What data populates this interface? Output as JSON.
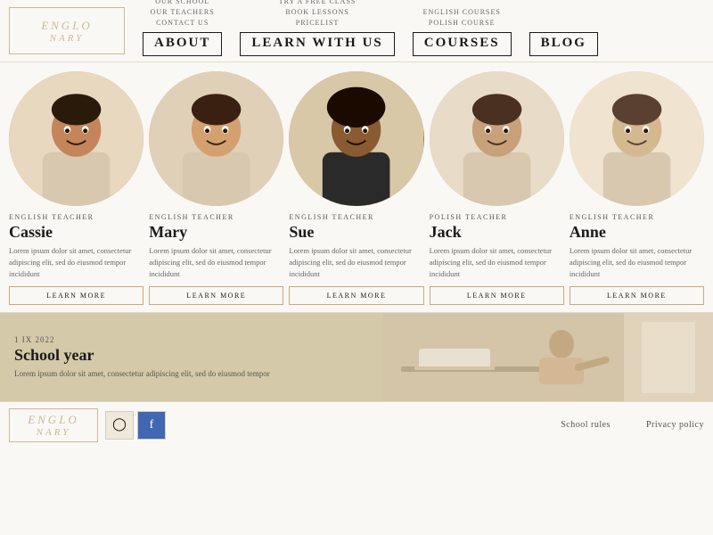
{
  "logo": {
    "line1": "ENGLO",
    "line2": "NARY"
  },
  "nav": {
    "about": {
      "label": "ABOUT",
      "sub_links": [
        "OUR SCHOOL",
        "OUR TEACHERS",
        "CONTACT US"
      ]
    },
    "learn": {
      "label": "LEARN WITH US",
      "sub_links": [
        "TRY A FREE CLASS",
        "BOOK LESSONS",
        "PRICELIST"
      ]
    },
    "courses": {
      "label": "COURSES",
      "sub_links": [
        "ENGLISH COURSES",
        "POLISH COURSE"
      ]
    },
    "blog": {
      "label": "BLOG",
      "sub_links": []
    }
  },
  "teachers": [
    {
      "role": "ENGLISH TEACHER",
      "name": "Cassie",
      "description": "Lorem ipsum dolor sit amet, consectetur adipiscing elit, sed do eiusmod tempor incididunt",
      "btn_label": "LEARN MORE",
      "img_class": "img-cassie"
    },
    {
      "role": "ENGLISH TEACHER",
      "name": "Mary",
      "description": "Lorem ipsum dolor sit amet, consectetur adipiscing elit, sed do eiusmod tempor incididunt",
      "btn_label": "LEARN MORE",
      "img_class": "img-mary"
    },
    {
      "role": "ENGLISH TEACHER",
      "name": "Sue",
      "description": "Lorem ipsum dolor sit amet, consectetur adipiscing elit, sed do eiusmod tempor incididunt",
      "btn_label": "LEARN MORE",
      "img_class": "img-sue"
    },
    {
      "role": "POLISH TEACHER",
      "name": "Jack",
      "description": "Lorem ipsum dolor sit amet, consectetur adipiscing elit, sed do eiusmod tempor incididunt",
      "btn_label": "LEARN MORE",
      "img_class": "img-jack"
    },
    {
      "role": "ENGLISH TEACHER",
      "name": "Anne",
      "description": "Lorem ipsum dolor sit amet, consectetur adipiscing elit, sed do eiusmod tempor incididunt",
      "btn_label": "LEARN MORE",
      "img_class": "img-anne"
    }
  ],
  "blog": {
    "date": "1 IX 2022",
    "title": "School year",
    "description": "Lorem ipsum dolor sit amet, consectetur adipiscing elit, sed do eiusmod tempor"
  },
  "footer": {
    "logo_line1": "ENGLO",
    "logo_line2": "NARY",
    "links": [
      "School rules",
      "Privacy policy"
    ]
  }
}
